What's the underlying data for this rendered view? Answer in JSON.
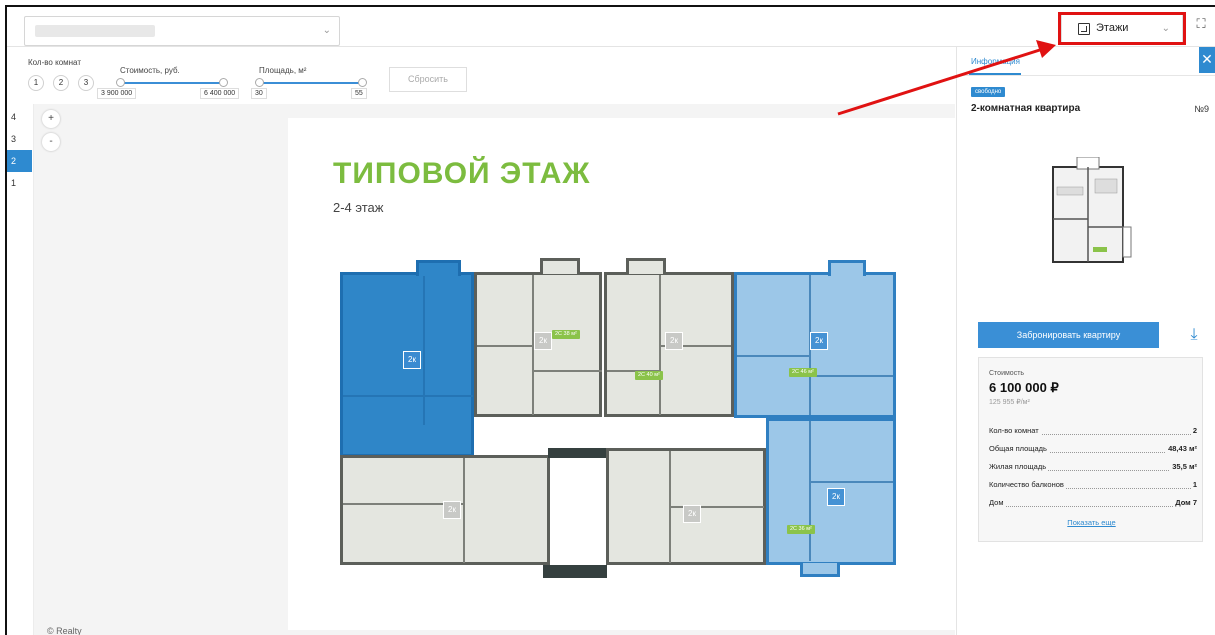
{
  "colors": {
    "accent": "#2e8ad0",
    "green": "#7cbc3f",
    "highlight": "#e01212"
  },
  "toolbar": {
    "floors_label": "Этажи",
    "fullscreen_icon": "fullscreen-icon"
  },
  "filters": {
    "rooms_label": "Кол-во комнат",
    "rooms": [
      "1",
      "2",
      "3"
    ],
    "price_label": "Стоимость, руб.",
    "price_min": "3 900 000",
    "price_max": "6 400 000",
    "area_label": "Площадь, м²",
    "area_min": "30",
    "area_max": "55",
    "reset_label": "Сбросить"
  },
  "floors": [
    "4",
    "3",
    "2",
    "1"
  ],
  "active_floor": "2",
  "zoom": {
    "plus": "+",
    "minus": "-"
  },
  "plan": {
    "title": "ТИПОВОЙ ЭТАЖ",
    "subtitle": "2-4 этаж",
    "badge": "2к",
    "areas": [
      "2С 38 м²",
      "2С 40 м²",
      "2С 46 м²",
      "2С 36 м²"
    ],
    "copyright": "© Realty"
  },
  "panel": {
    "tab": "Информация",
    "status": "свободно",
    "title": "2-комнатная квартира",
    "number": "№9",
    "book_label": "Забронировать квартиру",
    "price_label": "Стоимость",
    "price": "6 100 000 ₽",
    "price_per_m": "125 955 ₽/м²",
    "rows": [
      {
        "k": "Кол-во комнат",
        "v": "2"
      },
      {
        "k": "Общая площадь",
        "v": "48,43 м²"
      },
      {
        "k": "Жилая площадь",
        "v": "35,5 м²"
      },
      {
        "k": "Количество балконов",
        "v": "1"
      },
      {
        "k": "Дом",
        "v": "Дом 7"
      }
    ],
    "more_label": "Показать еще"
  }
}
